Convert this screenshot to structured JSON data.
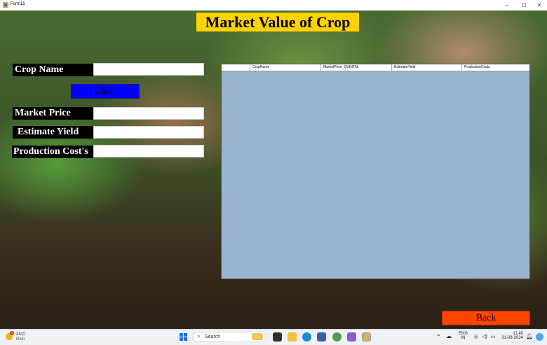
{
  "window": {
    "title": "Form15",
    "minimize": "–",
    "maximize": "☐",
    "close": "✕"
  },
  "page": {
    "title": "Market Value of Crop"
  },
  "form": {
    "crop_name_label": "Crop Name",
    "crop_name_value": "",
    "clear_label": "Clear",
    "market_price_label": "Market Price",
    "market_price_value": "",
    "estimate_yield_label": "Estimate Yield",
    "estimate_yield_value": "",
    "production_cost_label": "Production Cost's",
    "production_cost_value": "",
    "back_label": "Back"
  },
  "grid": {
    "columns": [
      "CropName",
      "MarketPrice_QUINTAL",
      "EstimateYield",
      "ProductionCosts"
    ],
    "rows": []
  },
  "taskbar": {
    "weather_temp": "24°C",
    "weather_cond": "Rain",
    "weather_badge": "1",
    "search_placeholder": "Search",
    "lang_line1": "ENG",
    "lang_line2": "IN",
    "time": "11:40",
    "date": "31-08-2024"
  },
  "colors": {
    "title_bg": "#ffd200",
    "clear_bg": "#0000ff",
    "back_bg": "#ff4500",
    "grid_bg": "#9ab3d0"
  }
}
